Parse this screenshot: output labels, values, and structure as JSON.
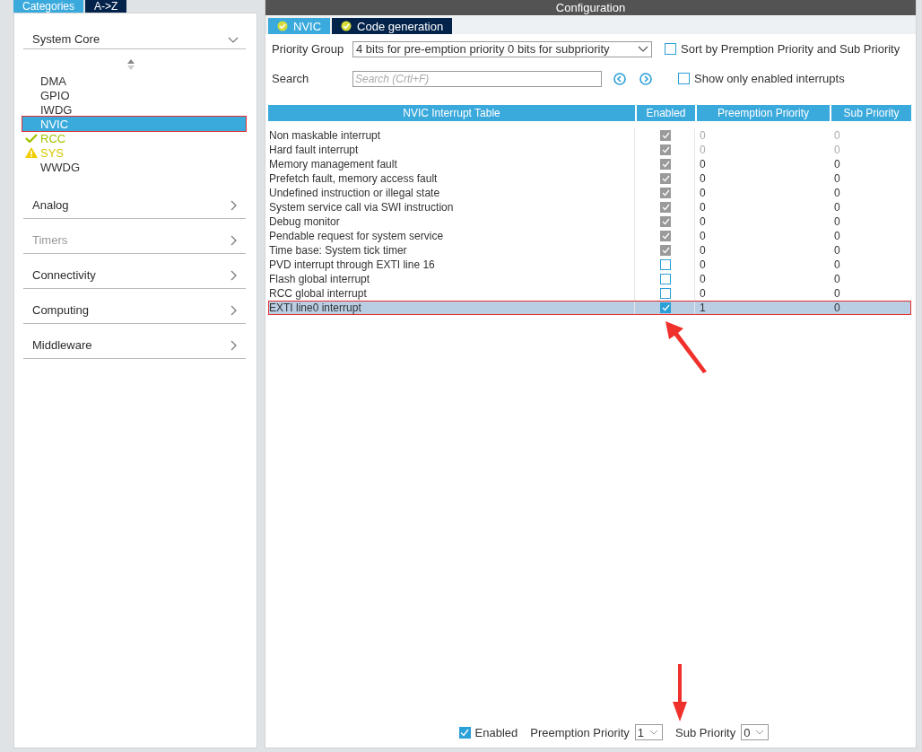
{
  "left_tabs": [
    {
      "label": "Categories",
      "selected": true
    },
    {
      "label": "A->Z",
      "selected": false
    }
  ],
  "categories": [
    {
      "label": "System Core",
      "expanded": true,
      "disabled": false,
      "items": [
        {
          "label": "DMA",
          "selected": false,
          "kind": "plain",
          "highlighted": false
        },
        {
          "label": "GPIO",
          "selected": false,
          "kind": "plain",
          "highlighted": false
        },
        {
          "label": "IWDG",
          "selected": false,
          "kind": "plain",
          "highlighted": false
        },
        {
          "label": "NVIC",
          "selected": true,
          "kind": "plain",
          "highlighted": true
        },
        {
          "label": "RCC",
          "selected": false,
          "kind": "ok",
          "highlighted": false
        },
        {
          "label": "SYS",
          "selected": false,
          "kind": "warning",
          "highlighted": false
        },
        {
          "label": "WWDG",
          "selected": false,
          "kind": "plain",
          "highlighted": false
        }
      ]
    },
    {
      "label": "Analog",
      "expanded": false,
      "disabled": false
    },
    {
      "label": "Timers",
      "expanded": false,
      "disabled": true
    },
    {
      "label": "Connectivity",
      "expanded": false,
      "disabled": false
    },
    {
      "label": "Computing",
      "expanded": false,
      "disabled": false
    },
    {
      "label": "Middleware",
      "expanded": false,
      "disabled": false
    }
  ],
  "config": {
    "title": "Configuration",
    "tabs": [
      {
        "label": "NVIC",
        "selected": true
      },
      {
        "label": "Code generation",
        "selected": false
      }
    ],
    "priority_group": {
      "label": "Priority Group",
      "value": "4 bits for pre-emption priority 0 bits for subpriority"
    },
    "search": {
      "label": "Search",
      "placeholder": "Search (Crtl+F)"
    },
    "options": [
      {
        "label": "Sort by Premption Priority and Sub Priority",
        "checked": false
      },
      {
        "label": "Show only enabled interrupts",
        "checked": false
      }
    ],
    "table": {
      "columns": [
        "NVIC Interrupt Table",
        "Enabled",
        "Preemption Priority",
        "Sub Priority"
      ],
      "rows": [
        {
          "name": "Non maskable interrupt",
          "enabled": true,
          "disabled": true,
          "priority_fixed": true,
          "preemption": "0",
          "sub": "0",
          "selected": false,
          "highlighted": false
        },
        {
          "name": "Hard fault interrupt",
          "enabled": true,
          "disabled": true,
          "priority_fixed": true,
          "preemption": "0",
          "sub": "0",
          "selected": false,
          "highlighted": false
        },
        {
          "name": "Memory management fault",
          "enabled": true,
          "disabled": true,
          "priority_fixed": false,
          "preemption": "0",
          "sub": "0",
          "selected": false,
          "highlighted": false
        },
        {
          "name": "Prefetch fault, memory access fault",
          "enabled": true,
          "disabled": true,
          "priority_fixed": false,
          "preemption": "0",
          "sub": "0",
          "selected": false,
          "highlighted": false
        },
        {
          "name": "Undefined instruction or illegal state",
          "enabled": true,
          "disabled": true,
          "priority_fixed": false,
          "preemption": "0",
          "sub": "0",
          "selected": false,
          "highlighted": false
        },
        {
          "name": "System service call via SWI instruction",
          "enabled": true,
          "disabled": true,
          "priority_fixed": false,
          "preemption": "0",
          "sub": "0",
          "selected": false,
          "highlighted": false
        },
        {
          "name": "Debug monitor",
          "enabled": true,
          "disabled": true,
          "priority_fixed": false,
          "preemption": "0",
          "sub": "0",
          "selected": false,
          "highlighted": false
        },
        {
          "name": "Pendable request for system service",
          "enabled": true,
          "disabled": true,
          "priority_fixed": false,
          "preemption": "0",
          "sub": "0",
          "selected": false,
          "highlighted": false
        },
        {
          "name": "Time base: System tick timer",
          "enabled": true,
          "disabled": true,
          "priority_fixed": false,
          "preemption": "0",
          "sub": "0",
          "selected": false,
          "highlighted": false
        },
        {
          "name": "PVD interrupt through EXTI line 16",
          "enabled": false,
          "disabled": false,
          "priority_fixed": false,
          "preemption": "0",
          "sub": "0",
          "selected": false,
          "highlighted": false
        },
        {
          "name": "Flash global interrupt",
          "enabled": false,
          "disabled": false,
          "priority_fixed": false,
          "preemption": "0",
          "sub": "0",
          "selected": false,
          "highlighted": false
        },
        {
          "name": "RCC global interrupt",
          "enabled": false,
          "disabled": false,
          "priority_fixed": false,
          "preemption": "0",
          "sub": "0",
          "selected": false,
          "highlighted": false
        },
        {
          "name": "EXTI line0 interrupt",
          "enabled": true,
          "disabled": false,
          "priority_fixed": false,
          "preemption": "1",
          "sub": "0",
          "selected": true,
          "highlighted": true
        }
      ]
    },
    "bottom": {
      "enabled": {
        "label": "Enabled",
        "checked": true
      },
      "preemption": {
        "label": "Preemption Priority",
        "value": "1"
      },
      "sub": {
        "label": "Sub Priority",
        "value": "0"
      }
    }
  }
}
